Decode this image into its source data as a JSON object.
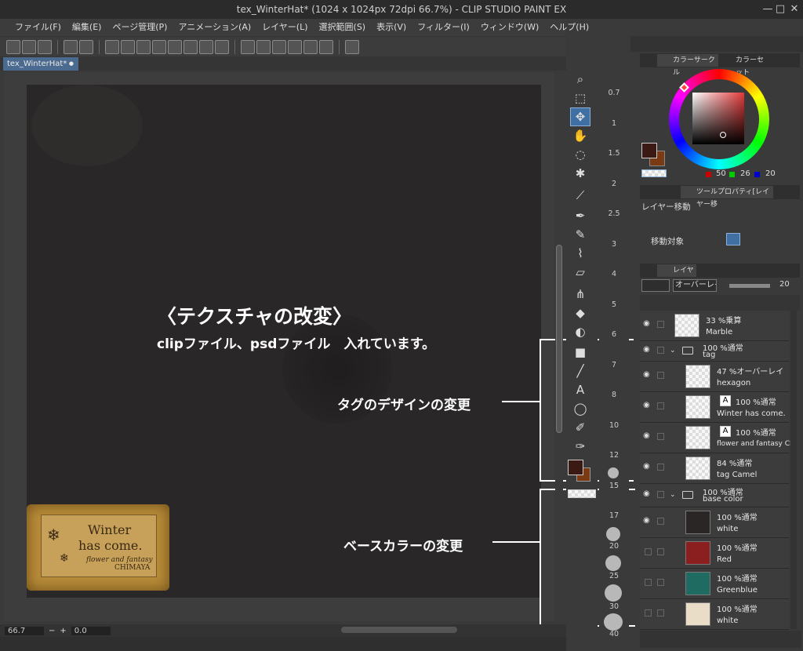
{
  "window": {
    "title": "tex_WinterHat* (1024 x 1024px 72dpi 66.7%) - CLIP STUDIO PAINT EX",
    "controls": [
      "—",
      "□",
      "✕"
    ]
  },
  "menu": [
    "ファイル(F)",
    "編集(E)",
    "ページ管理(P)",
    "アニメーション(A)",
    "レイヤー(L)",
    "選択範囲(S)",
    "表示(V)",
    "フィルター(I)",
    "ウィンドウ(W)",
    "ヘルプ(H)"
  ],
  "tab": {
    "label": "tex_WinterHat*",
    "close": "●"
  },
  "status": {
    "zoom": "66.7",
    "angle": "0.0"
  },
  "brush_sizes": [
    "0.7",
    "1",
    "1.5",
    "2",
    "2.5",
    "3",
    "4",
    "5",
    "6",
    "7",
    "8",
    "10",
    "12",
    "15",
    "17",
    "20",
    "25",
    "30",
    "40"
  ],
  "color_panel": {
    "tab1": "カラーサークル",
    "tab2": "カラーセット",
    "r": "50",
    "g": "26",
    "b": "20"
  },
  "tool_property": {
    "tab": "ツールプロパティ[レイヤー移",
    "title": "レイヤー移動",
    "target_label": "移動対象"
  },
  "layer_panel": {
    "tab": "レイヤー",
    "blend": "オーバーレイ",
    "opacity": "20"
  },
  "layers": [
    {
      "mode": "33 %乗算",
      "name": "Marble"
    },
    {
      "mode": "100 %通常",
      "name": "tag",
      "folder": true
    },
    {
      "mode": "47 %オーバーレイ",
      "name": "hexagon"
    },
    {
      "mode": "100 %通常",
      "name": "Winter has come."
    },
    {
      "mode": "100 %通常",
      "name": "flower and fantasy CHI"
    },
    {
      "mode": "84 %通常",
      "name": "tag Camel"
    },
    {
      "mode": "100 %通常",
      "name": "base color",
      "folder": true
    },
    {
      "mode": "100 %通常",
      "name": "white"
    },
    {
      "mode": "100 %通常",
      "name": "Red"
    },
    {
      "mode": "100 %通常",
      "name": "Greenblue"
    },
    {
      "mode": "100 %通常",
      "name": "white"
    }
  ],
  "annotations": {
    "heading": "〈テクスチャの改変〉",
    "subline": "clipファイル、psdファイル　入れています。",
    "tag_design": "タグのデザインの変更",
    "base_color": "ベースカラーの変更"
  },
  "tag_art": {
    "line1": "Winter",
    "line2": "has come.",
    "line3": "flower and fantasy",
    "line4": "CHIMAYA"
  },
  "colors": {
    "accent": "#3f6fa3",
    "main_color": "#3b1a14",
    "sub_color": "#7a3a14",
    "layer_red": "#8b1e1e",
    "layer_greenblue": "#1f6b62",
    "layer_white": "#e9ddc8",
    "layer_dark": "#2a2626"
  }
}
